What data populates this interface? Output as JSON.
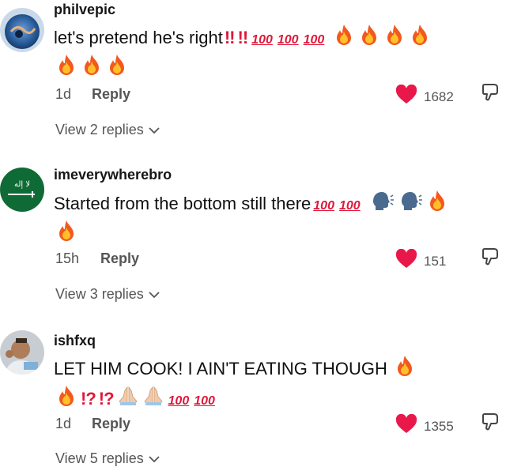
{
  "comments": [
    {
      "username": "philvepic",
      "text": "let's pretend he's right",
      "time": "1d",
      "reply_label": "Reply",
      "likes": "1682",
      "view_replies": "View 2 replies"
    },
    {
      "username": "imeverywherebro",
      "text": "Started from the bottom still there",
      "time": "15h",
      "reply_label": "Reply",
      "likes": "151",
      "view_replies": "View 3 replies"
    },
    {
      "username": "ishfxq",
      "text": "LET HIM COOK! I AIN'T EATING THOUGH",
      "time": "1d",
      "reply_label": "Reply",
      "likes": "1355",
      "view_replies": "View 5 replies"
    }
  ],
  "emoji": {
    "double_bang": "!!",
    "interrobang": "!?",
    "hundred": "100"
  },
  "colors": {
    "heart": "#e8194a",
    "emoji_red": "#e0183a",
    "meta_gray": "#555555"
  }
}
